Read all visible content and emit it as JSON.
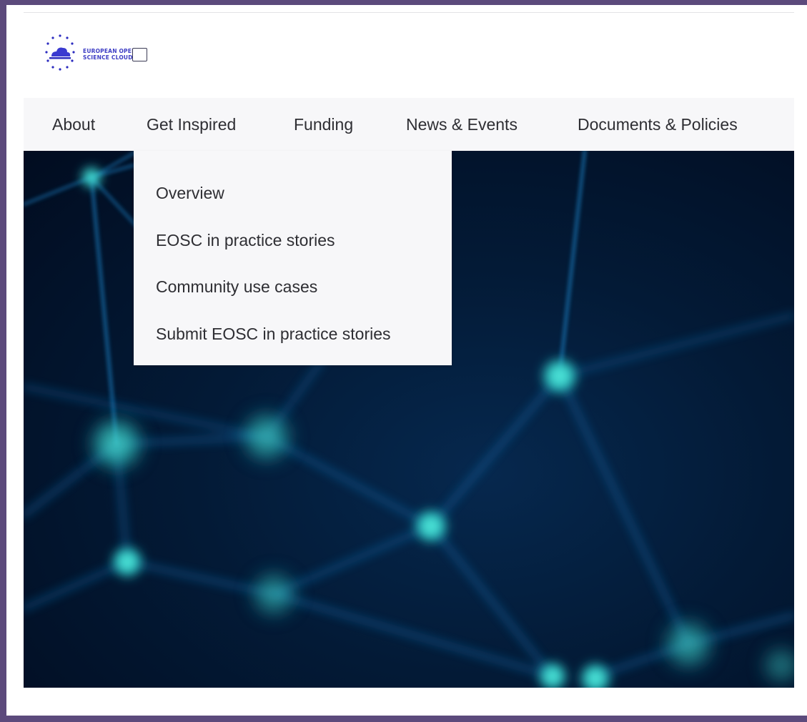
{
  "logo": {
    "line1": "EUROPEAN OPEN",
    "line2": "SCIENCE CLOUD"
  },
  "nav": {
    "items": [
      {
        "label": "About"
      },
      {
        "label": "Get Inspired"
      },
      {
        "label": "Funding"
      },
      {
        "label": "News & Events"
      },
      {
        "label": "Documents & Policies"
      }
    ]
  },
  "dropdown": {
    "items": [
      {
        "label": "Overview"
      },
      {
        "label": "EOSC in practice stories"
      },
      {
        "label": "Community use cases"
      },
      {
        "label": "Submit EOSC in practice stories"
      }
    ]
  },
  "colors": {
    "frame": "#5c4a7c",
    "navbar_bg": "#f7f7f9",
    "text": "#2e2e33",
    "logo_text": "#3d3dc4",
    "hero_bg": "#021634",
    "node_glow": "#2fd0c8",
    "link_line": "#1a7fc4"
  }
}
